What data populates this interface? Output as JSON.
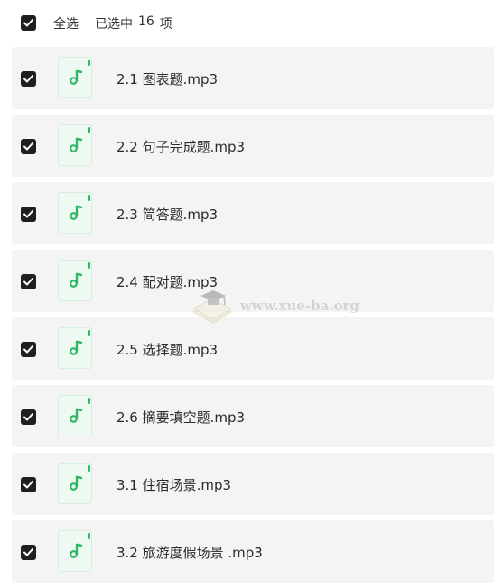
{
  "header": {
    "select_all_label": "全选",
    "selected_prefix": "已选中",
    "selected_count": "16",
    "selected_suffix": "项",
    "checked": true
  },
  "files": [
    {
      "name": "2.1 图表题.mp3",
      "checked": true
    },
    {
      "name": "2.2 句子完成题.mp3",
      "checked": true
    },
    {
      "name": "2.3 简答题.mp3",
      "checked": true
    },
    {
      "name": "2.4 配对题.mp3",
      "checked": true
    },
    {
      "name": "2.5 选择题.mp3",
      "checked": true
    },
    {
      "name": "2.6 摘要填空题.mp3",
      "checked": true
    },
    {
      "name": "3.1 住宿场景.mp3",
      "checked": true
    },
    {
      "name": "3.2 旅游度假场景 .mp3",
      "checked": true
    }
  ],
  "icons": {
    "checkbox": "checkbox-checked-icon",
    "file": "audio-file-icon"
  },
  "colors": {
    "checkbox_fill": "#1f1f1f",
    "audio_accent": "#2fb866",
    "row_background": "#f4f4f4"
  },
  "watermark": {
    "text": "www.xue-ba.org"
  }
}
